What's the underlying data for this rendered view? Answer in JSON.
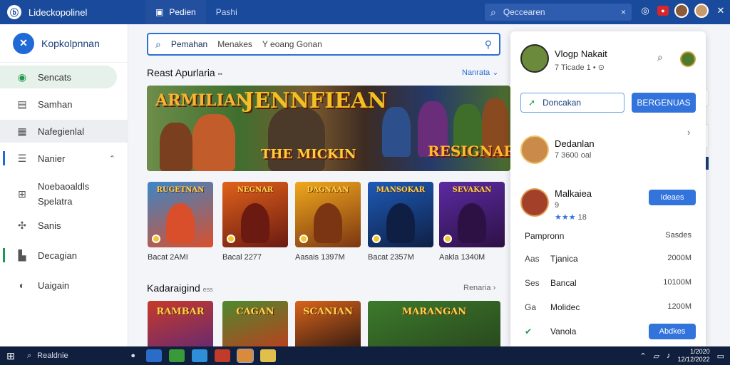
{
  "window": {
    "app_name": "Lideckopolinel",
    "tabs": [
      {
        "label": "Pedien",
        "active": true
      },
      {
        "label": "Pashi",
        "active": false
      }
    ],
    "search_placeholder": "Qeccearen",
    "search_close": "×",
    "controls": {
      "close": "✕"
    }
  },
  "sidebar": {
    "brand": "Kopkolpnnan",
    "items": [
      {
        "label": "Sencats",
        "icon": "controller-icon",
        "active": true
      },
      {
        "label": "Samhan",
        "icon": "library-icon"
      },
      {
        "label": "Nafegienlal",
        "icon": "store-icon",
        "hover": true
      },
      {
        "label": "Nanier",
        "icon": "list-icon",
        "expandable": true
      },
      {
        "label": "Noebaoaldls",
        "label2": "Spelatra",
        "icon": "grid-icon"
      },
      {
        "label": "Sanis",
        "icon": "puzzle-icon"
      },
      {
        "label": "Decagian",
        "icon": "download-icon"
      },
      {
        "label": "Uaigain",
        "icon": "settings-icon"
      }
    ]
  },
  "main": {
    "search_segments": [
      "Pemahan",
      "Menakes",
      "Y eoang Gonan"
    ],
    "section1": {
      "title": "Reast Apurlaria",
      "title_suffix": "••",
      "link": "Nanrata ⌄"
    },
    "banner": {
      "text1": "ARMILIAN",
      "text2": "JENNFIEAN",
      "text3": "THE MICKIN",
      "text4": "RESIGNAR"
    },
    "cards": [
      {
        "title": "RUGETNAN",
        "label": "Bacat 2AMI",
        "colors": [
          "#3a86c8",
          "#d94f2c"
        ]
      },
      {
        "title": "NEGNAR",
        "label": "Bacal 2277",
        "colors": [
          "#e0621a",
          "#6b1a12"
        ]
      },
      {
        "title": "DAGNAAN",
        "label": "Aasais 1397M",
        "colors": [
          "#f0a91c",
          "#7b3512"
        ]
      },
      {
        "title": "MANSOKAR",
        "label": "Bacat 2357M",
        "colors": [
          "#1e5bb8",
          "#0f1f44"
        ]
      },
      {
        "title": "SEVAKAN",
        "label": "Aakla 1340M",
        "colors": [
          "#5c2aa3",
          "#2d1144"
        ]
      }
    ],
    "section2": {
      "title": "Kadaraigind",
      "title_suffix": "ess",
      "link": "Renaria ›"
    },
    "cards2": [
      {
        "title": "RAMBAR",
        "colors": [
          "#c73a2a",
          "#6b2a6e"
        ]
      },
      {
        "title": "CAGAN",
        "colors": [
          "#4d8a2f",
          "#b7421f"
        ]
      },
      {
        "title": "SCANIAN",
        "colors": [
          "#d9641a",
          "#3c1e12"
        ]
      },
      {
        "title": "MARANGAN",
        "colors": [
          "#3c7a2c",
          "#2a4a1e"
        ]
      }
    ]
  },
  "panel": {
    "user": {
      "name": "Vlogp Nakait",
      "sub": "7 Ticade 1 • ⊙"
    },
    "follow_label": "Doncakan",
    "primary_label": "BERGENUAS",
    "friend1": {
      "name": "Dedanlan",
      "sub": "7 3600 oal",
      "chev": "›"
    },
    "friend2": {
      "name": "Malkaiea",
      "sub": "9",
      "stars": "★★★",
      "rating": "18",
      "button": "Ideaes"
    },
    "rows": [
      {
        "k": "",
        "name": "Pampronn",
        "v": "Sasdes"
      },
      {
        "k": "Aas",
        "name": "Tjanica",
        "v": "2000M"
      },
      {
        "k": "Ses",
        "name": "Bancal",
        "v": "10100M"
      },
      {
        "k": "Ga",
        "name": "Molidec",
        "v": "1200M"
      },
      {
        "k": "✔",
        "name": "Vanola",
        "v": ""
      }
    ],
    "last_button": "Abdkes"
  },
  "taskbar": {
    "search": "Realdnie",
    "time": "1/2020",
    "date": "12/12/2022"
  },
  "colors": {
    "titlebar": "#1a4a9c",
    "accent": "#3273dc",
    "active_green": "#1f9a4d",
    "taskbar": "#0f1f3d"
  }
}
